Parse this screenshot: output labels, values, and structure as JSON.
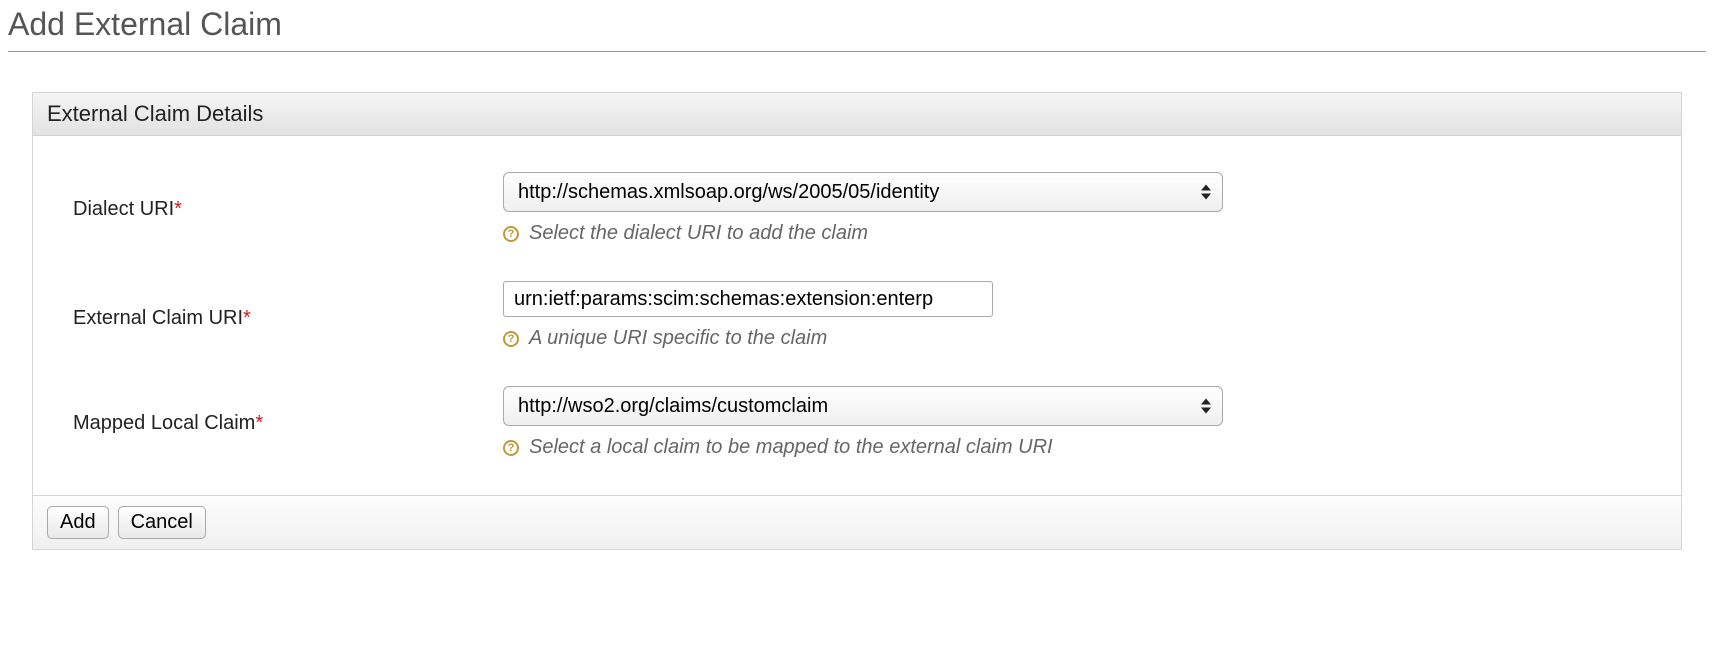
{
  "page": {
    "title": "Add External Claim"
  },
  "panel": {
    "title": "External Claim Details"
  },
  "fields": {
    "dialect": {
      "label": "Dialect URI",
      "required": "*",
      "value": "http://schemas.xmlsoap.org/ws/2005/05/identity",
      "hint": "Select the dialect URI to add the claim"
    },
    "externalClaim": {
      "label": "External Claim URI",
      "required": "*",
      "value": "urn:ietf:params:scim:schemas:extension:enterp",
      "hint": "A unique URI specific to the claim"
    },
    "mappedLocal": {
      "label": "Mapped Local Claim",
      "required": "*",
      "value": "http://wso2.org/claims/customclaim",
      "hint": "Select a local claim to be mapped to the external claim URI"
    }
  },
  "buttons": {
    "add": "Add",
    "cancel": "Cancel"
  }
}
